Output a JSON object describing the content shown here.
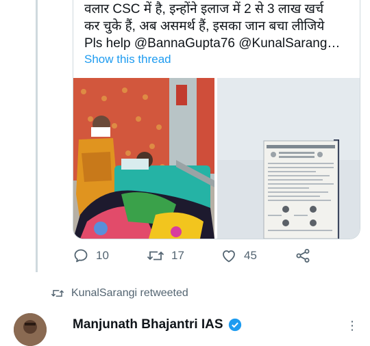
{
  "tweet": {
    "text_lines": [
      "वलार CSC में है, इन्होंने इलाज में 2 से 3 लाख खर्च",
      "कर चुके हैं, अब असमर्थ हैं, इसका जान बचा लीजिये",
      "Pls help @BannaGupta76 @KunalSarang…"
    ],
    "show_thread": "Show this thread",
    "actions": {
      "reply_count": "10",
      "retweet_count": "17",
      "like_count": "45"
    }
  },
  "retweet_note": "KunalSarangi retweeted",
  "next_tweet": {
    "author": "Manjunath Bhajantri IAS"
  },
  "colors": {
    "accent": "#1d9bf0",
    "muted": "#536471",
    "border": "#cfd9de"
  }
}
